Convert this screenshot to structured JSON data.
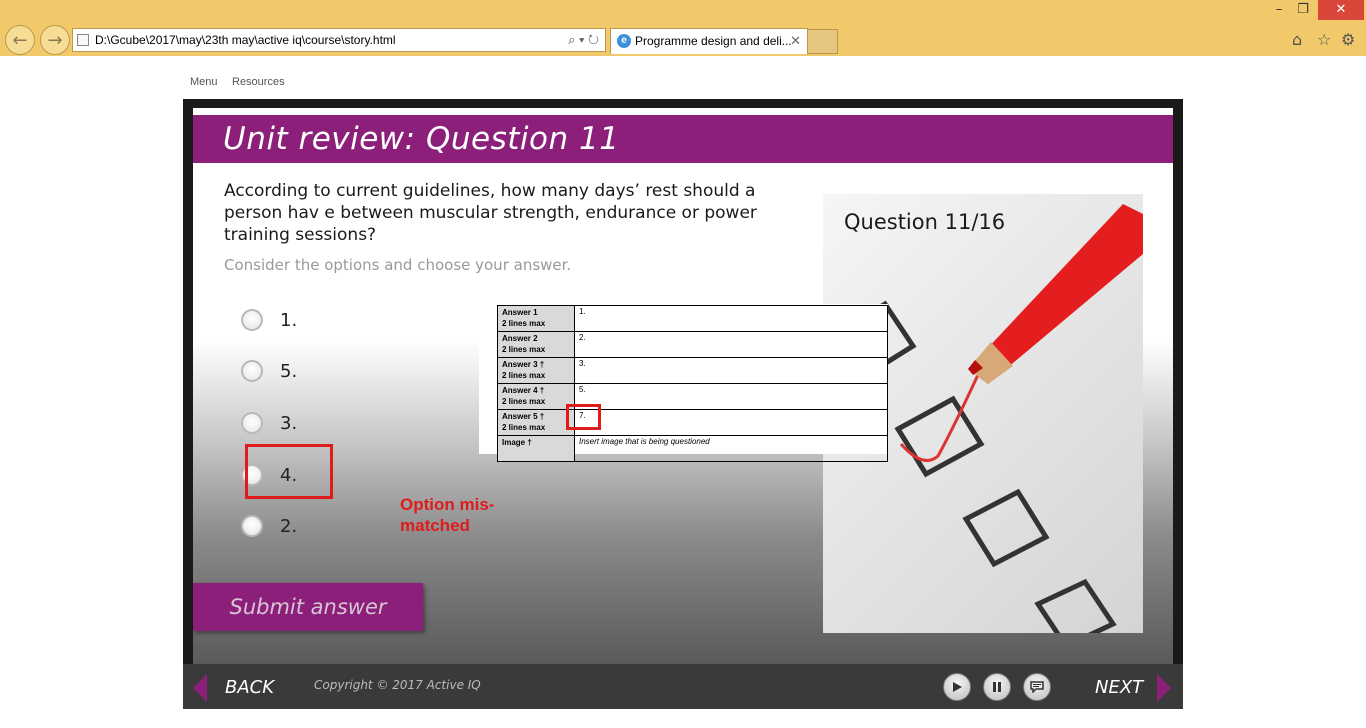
{
  "browser": {
    "address": "D:\\Gcube\\2017\\may\\23th may\\active iq\\course\\story.html",
    "tab_title": "Programme design and deli...",
    "window_minimize": "–",
    "window_restore": "❐",
    "window_close": "✕"
  },
  "page_menu": {
    "menu": "Menu",
    "resources": "Resources"
  },
  "slide": {
    "title": "Unit review: Question 11",
    "question": "According to current guidelines, how many days’ rest should a person hav e between muscular strength, endurance or power training sessions?",
    "instruction": "Consider the options and choose your answer.",
    "options": [
      "1.",
      "5.",
      "3.",
      "4.",
      "2."
    ],
    "counter": "Question 11/16",
    "submit": "Submit answer"
  },
  "spec_table": {
    "rows": [
      {
        "label1": "Answer 1",
        "label2": "2 lines max",
        "value": "1."
      },
      {
        "label1": "Answer 2",
        "label2": "2 lines max",
        "value": "2."
      },
      {
        "label1": "Answer 3 †",
        "label2": "2 lines max",
        "value": "3."
      },
      {
        "label1": "Answer 4 †",
        "label2": "2 lines max",
        "value": "5."
      },
      {
        "label1": "Answer 5 †",
        "label2": "2 lines max",
        "value": "7."
      },
      {
        "label1": "Image †",
        "label2": "",
        "value": "Insert image that is being questioned"
      }
    ]
  },
  "annotation": {
    "note": "Option mis-matched",
    "color": "#e01b1b"
  },
  "footer": {
    "back": "BACK",
    "next": "NEXT",
    "copyright": "Copyright © 2017 Active IQ"
  },
  "colors": {
    "brand_purple": "#8b1f7a",
    "chrome": "#f1c96b"
  }
}
